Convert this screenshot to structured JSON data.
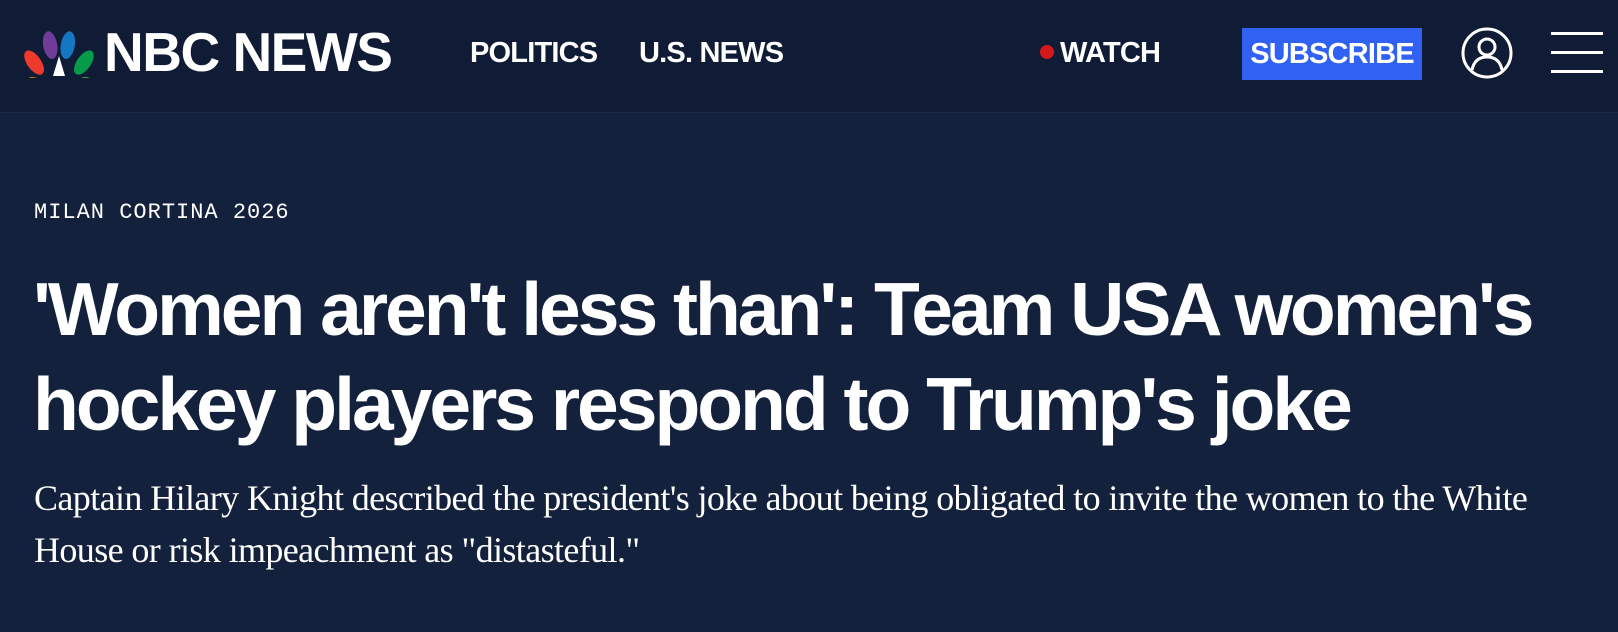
{
  "header": {
    "logo_text": "NBC NEWS",
    "nav": [
      {
        "label": "POLITICS"
      },
      {
        "label": "U.S. NEWS"
      }
    ],
    "watch_label": "WATCH",
    "subscribe_label": "SUBSCRIBE",
    "icons": {
      "logo": "nbc-peacock-icon",
      "live": "live-dot-icon",
      "account": "user-account-icon",
      "menu": "hamburger-menu-icon"
    }
  },
  "article": {
    "eyebrow": "MILAN CORTINA 2026",
    "headline": "'Women aren't less than': Team USA women's hockey players respond to Trump's joke",
    "dek": "Captain Hilary Knight described the president's joke about being obligated to invite the women to the White House or risk impeachment as \"distasteful.\""
  },
  "colors": {
    "background": "#13213d",
    "header_background": "#101c36",
    "subscribe_button": "#3061f2",
    "live_dot": "#d21a1a",
    "text": "#ffffff"
  }
}
